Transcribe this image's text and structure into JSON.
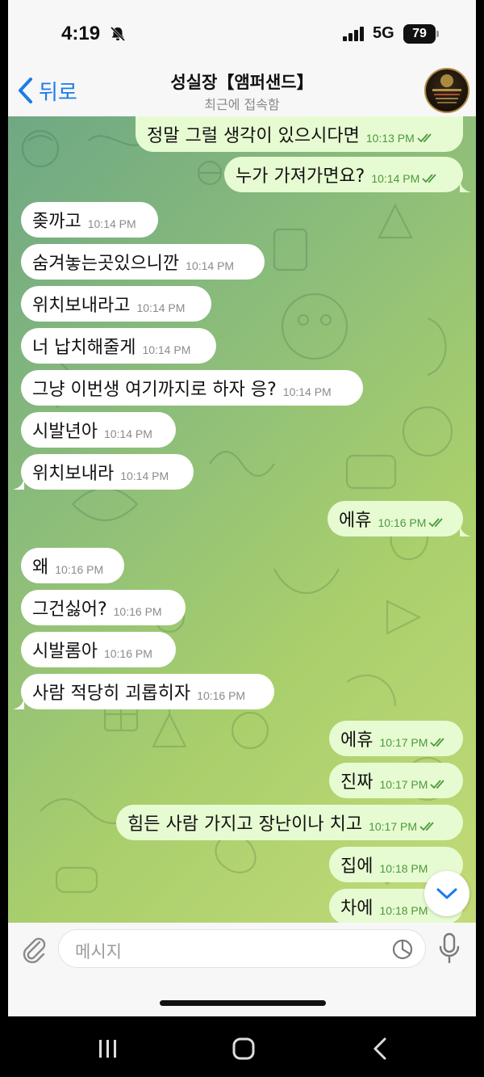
{
  "status_bar": {
    "time": "4:19",
    "network": "5G",
    "battery": "79",
    "icons": [
      "bell-muted-icon",
      "signal-icon",
      "battery-icon"
    ]
  },
  "header": {
    "back_label": "뒤로",
    "title": "성실장【앰퍼샌드】",
    "subtitle": "최근에 접속함"
  },
  "messages": [
    {
      "dir": "out",
      "text": "정말 그럴 생각이 있으시다면",
      "time": "10:13 PM",
      "read": true
    },
    {
      "dir": "out",
      "text": "누가 가져가면요?",
      "time": "10:14 PM",
      "read": true
    },
    {
      "dir": "in",
      "text": "좆까고",
      "time": "10:14 PM"
    },
    {
      "dir": "in",
      "text": "숨겨놓는곳있으니깐",
      "time": "10:14 PM"
    },
    {
      "dir": "in",
      "text": "위치보내라고",
      "time": "10:14 PM"
    },
    {
      "dir": "in",
      "text": "너 납치해줄게",
      "time": "10:14 PM"
    },
    {
      "dir": "in",
      "text": "그냥 이번생 여기까지로 하자 응?",
      "time": "10:14 PM"
    },
    {
      "dir": "in",
      "text": "시발년아",
      "time": "10:14 PM"
    },
    {
      "dir": "in",
      "text": "위치보내라",
      "time": "10:14 PM"
    },
    {
      "dir": "out",
      "text": "에휴",
      "time": "10:16 PM",
      "read": true
    },
    {
      "dir": "in",
      "text": "왜",
      "time": "10:16 PM"
    },
    {
      "dir": "in",
      "text": "그건싫어?",
      "time": "10:16 PM"
    },
    {
      "dir": "in",
      "text": "시발롬아",
      "time": "10:16 PM"
    },
    {
      "dir": "in",
      "text": "사람 적당히 괴롭히자",
      "time": "10:16 PM"
    },
    {
      "dir": "out",
      "text": "에휴",
      "time": "10:17 PM",
      "read": true
    },
    {
      "dir": "out",
      "text": "진짜",
      "time": "10:17 PM",
      "read": true
    },
    {
      "dir": "out",
      "text": "힘든 사람 가지고 장난이나 치고",
      "time": "10:17 PM",
      "read": true
    },
    {
      "dir": "out",
      "text": "집에",
      "time": "10:18 PM",
      "read": true
    },
    {
      "dir": "out",
      "text": "차에",
      "time": "10:18 PM",
      "read": true
    }
  ],
  "composer": {
    "placeholder": "메시지"
  },
  "colors": {
    "accent": "#1c7be8",
    "outgoing_bubble": "#e7fbd2",
    "incoming_bubble": "#ffffff",
    "read_tick": "#4a9a3a"
  }
}
